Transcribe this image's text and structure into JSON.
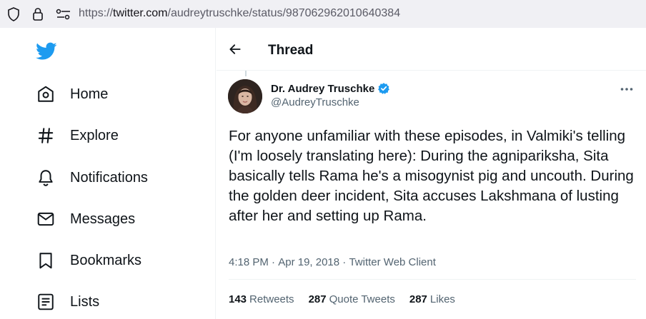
{
  "browser": {
    "url_prefix": "https://",
    "url_host": "twitter.com",
    "url_path": "/audreytruschke/status/987062962010640384"
  },
  "sidebar": {
    "items": [
      {
        "label": "Home",
        "icon": "home-icon"
      },
      {
        "label": "Explore",
        "icon": "hashtag-icon"
      },
      {
        "label": "Notifications",
        "icon": "bell-icon"
      },
      {
        "label": "Messages",
        "icon": "envelope-icon"
      },
      {
        "label": "Bookmarks",
        "icon": "bookmark-icon"
      },
      {
        "label": "Lists",
        "icon": "list-icon"
      }
    ]
  },
  "header": {
    "title": "Thread"
  },
  "tweet": {
    "author_name": "Dr. Audrey Truschke",
    "author_handle": "@AudreyTruschke",
    "text": "For anyone unfamiliar with these episodes, in Valmiki's telling (I'm loosely translating here): During the agnipariksha, Sita basically tells Rama he's a misogynist pig and uncouth. During the golden deer incident, Sita accuses Lakshmana of lusting after her and setting up Rama.",
    "time": "4:18 PM",
    "date": "Apr 19, 2018",
    "separator": " · ",
    "client": "Twitter Web Client",
    "stats": {
      "retweets_count": "143",
      "retweets_label": "Retweets",
      "quotes_count": "287",
      "quotes_label": "Quote Tweets",
      "likes_count": "287",
      "likes_label": "Likes"
    }
  },
  "colors": {
    "brand": "#1d9bf0",
    "text": "#0f1419",
    "muted": "#536471",
    "border": "#eff3f4"
  }
}
